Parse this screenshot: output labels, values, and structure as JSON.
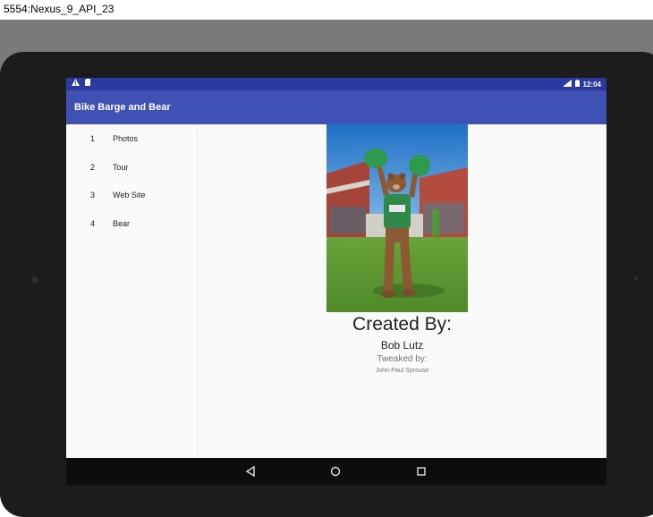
{
  "window": {
    "title": "5554:Nexus_9_API_23"
  },
  "statusbar": {
    "time": "12:04",
    "network": "3G"
  },
  "app": {
    "title": "Bike Barge and Bear"
  },
  "nav": {
    "items": [
      {
        "number": "1",
        "label": "Photos"
      },
      {
        "number": "2",
        "label": "Tour"
      },
      {
        "number": "3",
        "label": "Web Site"
      },
      {
        "number": "4",
        "label": "Bear"
      }
    ]
  },
  "credits": {
    "heading": "Created By:",
    "author": "Bob Lutz",
    "tweaked_label": "Tweaked by:",
    "tweaker": "John-Paul Sprouse"
  },
  "colors": {
    "appbar": "#3f51b5",
    "statusbar": "#2b3aa0",
    "background": "#fafafa"
  }
}
